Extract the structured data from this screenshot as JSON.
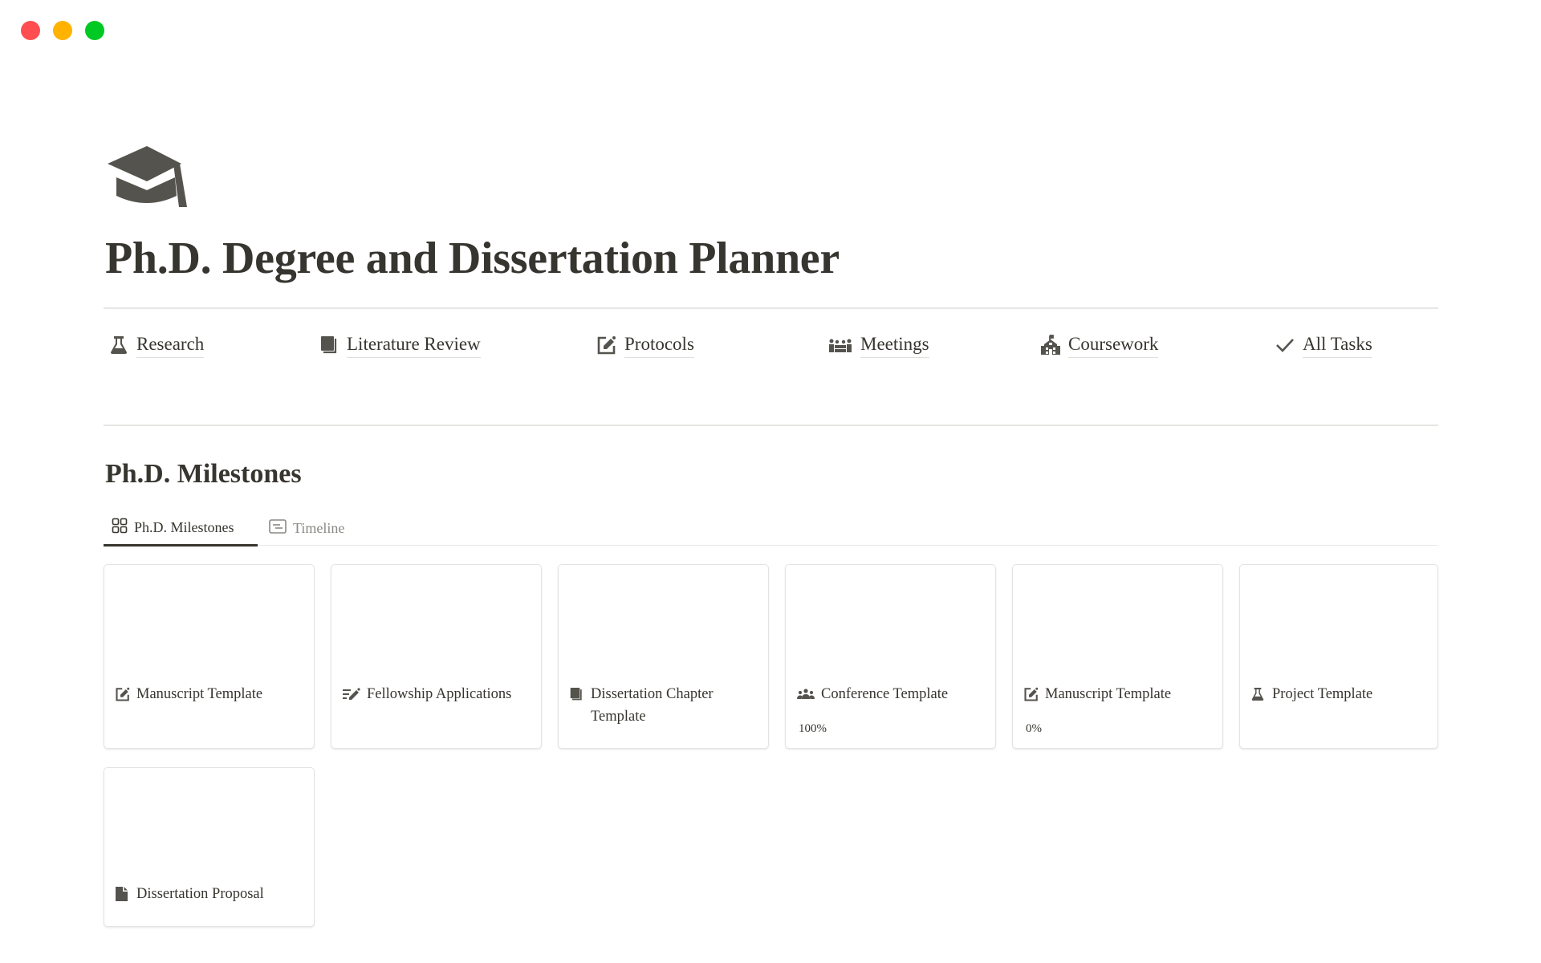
{
  "window": {
    "controls": [
      "close",
      "minimize",
      "maximize"
    ]
  },
  "page": {
    "icon": "graduation-cap-icon",
    "title": "Ph.D. Degree and Dissertation Planner"
  },
  "nav_links": [
    {
      "label": "Research",
      "icon": "flask-icon"
    },
    {
      "label": "Literature Review",
      "icon": "book-icon"
    },
    {
      "label": "Protocols",
      "icon": "edit-square-icon"
    },
    {
      "label": "Meetings",
      "icon": "meeting-people-icon"
    },
    {
      "label": "Coursework",
      "icon": "school-building-icon"
    },
    {
      "label": "All Tasks",
      "icon": "checkmark-icon"
    }
  ],
  "milestones": {
    "title": "Ph.D. Milestones",
    "tabs": [
      {
        "label": "Ph.D. Milestones",
        "icon": "gallery-grid-icon",
        "active": true
      },
      {
        "label": "Timeline",
        "icon": "timeline-icon",
        "active": false
      }
    ],
    "cards": [
      {
        "title": "Manuscript Template",
        "icon": "edit-square-icon",
        "progress": null
      },
      {
        "title": "Fellowship Applications",
        "icon": "list-edit-icon",
        "progress": null
      },
      {
        "title": "Dissertation Chapter Template",
        "icon": "book-icon",
        "progress": null
      },
      {
        "title": "Conference Template",
        "icon": "group-people-icon",
        "progress": "100%"
      },
      {
        "title": "Manuscript Template",
        "icon": "edit-square-icon",
        "progress": "0%"
      },
      {
        "title": "Project Template",
        "icon": "flask-icon",
        "progress": null
      },
      {
        "title": "Dissertation Proposal",
        "icon": "document-icon",
        "progress": null
      }
    ]
  }
}
